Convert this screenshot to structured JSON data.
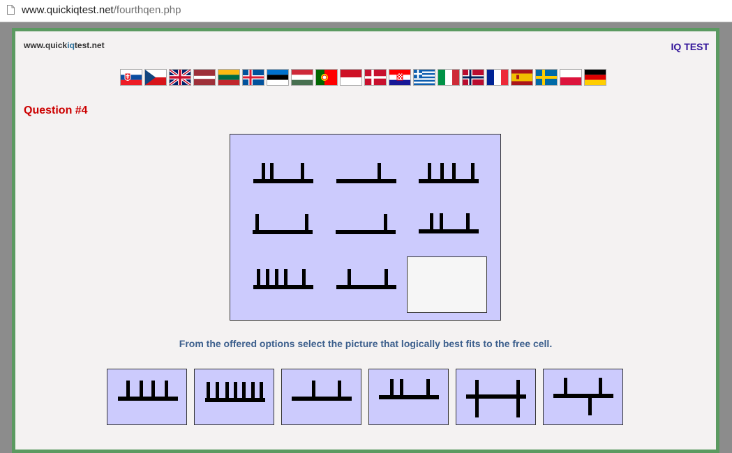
{
  "browser": {
    "url_domain": "www.quickiqtest.net",
    "url_path": "/fourthqen.php",
    "page_icon": "document-icon"
  },
  "header": {
    "site_name_prefix": "www.quick",
    "site_name_accent": "iq",
    "site_name_suffix": "test.net",
    "iq_test_link": "IQ TEST"
  },
  "flags": [
    "Slovakia",
    "Czech Republic",
    "United Kingdom",
    "Latvia",
    "Lithuania",
    "Iceland",
    "Estonia",
    "Hungary",
    "Portugal",
    "Indonesia",
    "Denmark",
    "Croatia",
    "Greece",
    "Italy",
    "Norway",
    "France",
    "Spain",
    "Sweden",
    "Poland",
    "Germany"
  ],
  "question": {
    "title": "Question #4",
    "instructions": "From the offered options select the picture that logically best fits to the free cell."
  },
  "colors": {
    "frame_border": "#5b9a61",
    "panel_bg": "#cccbfd",
    "question_title": "#cc0000",
    "instructions": "#3b5e8c",
    "iq_test_link": "#33169a"
  }
}
